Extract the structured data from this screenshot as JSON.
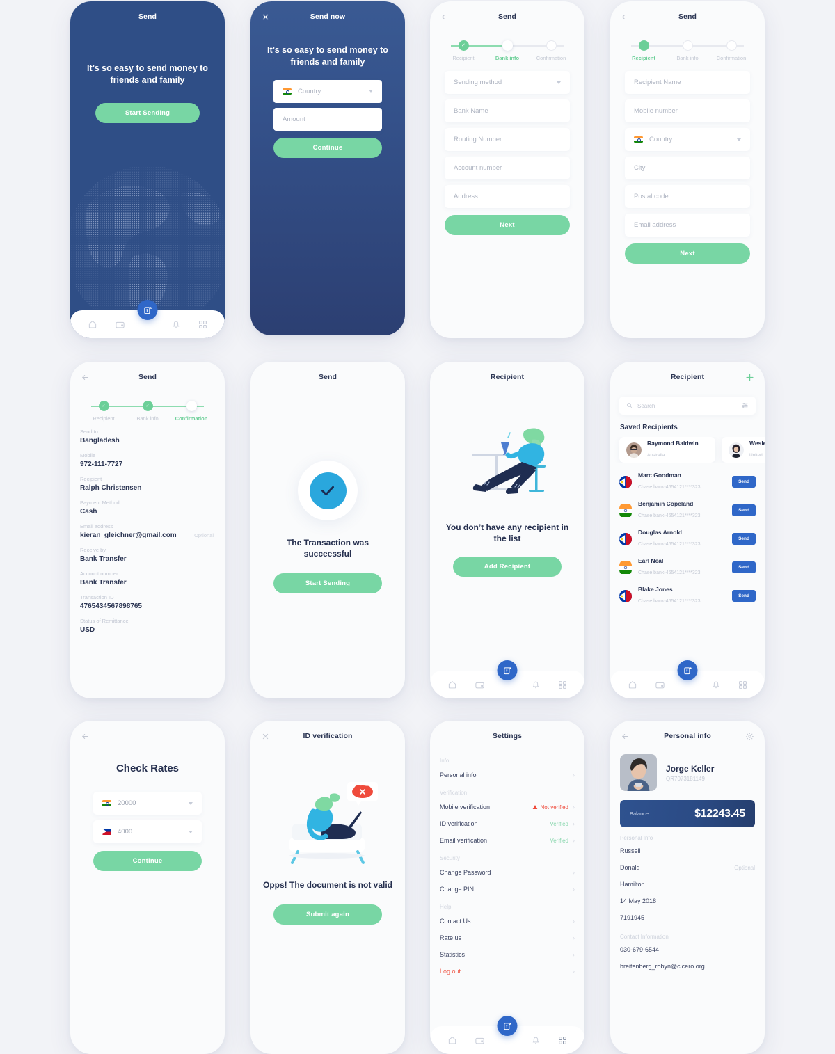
{
  "palette": {
    "page_bg": "#f2f3f7",
    "phone_bg": "#fafbfc",
    "brand_blue": "#2f67c8",
    "dark_navy": "#2f4e86",
    "accent_green": "#78d6a4",
    "step_green": "#6ccf98",
    "danger_red": "#ef4b3c",
    "text_dark": "#2b3553",
    "text_muted": "#c3c8d3"
  },
  "screens": {
    "onboarding": {
      "title": "Send",
      "headline": "It’s so easy to send money to friends and family",
      "cta": "Start Sending"
    },
    "send_now": {
      "title": "Send now",
      "close_icon": "close-icon",
      "headline": "It’s so easy to send money to friends and family",
      "country_placeholder": "Country",
      "amount_placeholder": "Amount",
      "cta": "Continue"
    },
    "bank_info": {
      "title": "Send",
      "back_icon": "back-arrow-icon",
      "steps": [
        {
          "label": "Recipient",
          "state": "done"
        },
        {
          "label": "Bank info",
          "state": "current"
        },
        {
          "label": "Confirmation",
          "state": "todo"
        }
      ],
      "fields": [
        {
          "placeholder": "Sending method",
          "type": "select"
        },
        {
          "placeholder": "Bank Name",
          "type": "text"
        },
        {
          "placeholder": "Routing Number",
          "type": "text"
        },
        {
          "placeholder": "Account number",
          "type": "text"
        },
        {
          "placeholder": "Address",
          "type": "text"
        }
      ],
      "cta": "Next"
    },
    "recipient_form": {
      "title": "Send",
      "back_icon": "back-arrow-icon",
      "steps": [
        {
          "label": "Recipient",
          "state": "current-filled"
        },
        {
          "label": "Bank info",
          "state": "todo"
        },
        {
          "label": "Confirmation",
          "state": "todo"
        }
      ],
      "fields": [
        {
          "placeholder": "Recipient Name",
          "type": "text"
        },
        {
          "placeholder": "Mobile number",
          "type": "text"
        },
        {
          "placeholder": "Country",
          "type": "select",
          "flag": "in"
        },
        {
          "placeholder": "City",
          "type": "text"
        },
        {
          "placeholder": "Postal code",
          "type": "text"
        },
        {
          "placeholder": "Email address",
          "type": "text"
        }
      ],
      "cta": "Next"
    },
    "confirmation": {
      "title": "Send",
      "back_icon": "back-arrow-icon",
      "steps": [
        {
          "label": "Recipient",
          "state": "done"
        },
        {
          "label": "Bank info",
          "state": "done"
        },
        {
          "label": "Confirmation",
          "state": "current"
        }
      ],
      "details": [
        {
          "key": "Send to",
          "value": "Bangladesh",
          "optional": ""
        },
        {
          "key": "Mobile",
          "value": "972-111-7727",
          "optional": ""
        },
        {
          "key": "Recipient",
          "value": "Ralph Christensen",
          "optional": ""
        },
        {
          "key": "Payment Method",
          "value": "Cash",
          "optional": ""
        },
        {
          "key": "Email address",
          "value": "kieran_gleichner@gmail.com",
          "optional": "Optional"
        },
        {
          "key": "Receive by",
          "value": "Bank Transfer",
          "optional": ""
        },
        {
          "key": "Account number",
          "value": "Bank Transfer",
          "optional": ""
        },
        {
          "key": "Transaction ID",
          "value": "4765434567898765",
          "optional": ""
        },
        {
          "key": "Status of Remittance",
          "value": "USD",
          "optional": ""
        }
      ]
    },
    "success": {
      "title": "Send",
      "check_icon": "check-icon",
      "message": "The Transaction was succeessful",
      "cta": "Start Sending"
    },
    "empty_recipient": {
      "title": "Recipient",
      "illustration": "person-at-table-illustration",
      "message": "You don’t have any recipient in the list",
      "cta": "Add Recipient"
    },
    "recipient_list": {
      "title": "Recipient",
      "add_icon": "plus-icon",
      "search_placeholder": "Search",
      "search_icon": "search-icon",
      "filter_icon": "filter-icon",
      "section_title": "Saved Recipients",
      "cards": [
        {
          "name": "Raymond Baldwin",
          "country": "Australia"
        },
        {
          "name": "Wesley",
          "country": "United"
        }
      ],
      "rows": [
        {
          "name": "Marc Goodman",
          "bank": "Chase bank-4654121****323",
          "flag": "ph",
          "action": "Send"
        },
        {
          "name": "Benjamin Copeland",
          "bank": "Chase bank-4654121****323",
          "flag": "in",
          "action": "Send"
        },
        {
          "name": "Douglas Arnold",
          "bank": "Chase bank-4654121****323",
          "flag": "ph",
          "action": "Send"
        },
        {
          "name": "Earl Neal",
          "bank": "Chase bank-4654121****323",
          "flag": "in",
          "action": "Send"
        },
        {
          "name": "Blake Jones",
          "bank": "Chase bank-4654121****323",
          "flag": "ph",
          "action": "Send"
        }
      ]
    },
    "check_rates": {
      "back_icon": "back-arrow-icon",
      "heading": "Check Rates",
      "from": {
        "flag": "in",
        "value": "20000"
      },
      "to": {
        "flag": "ph",
        "value": "4000"
      },
      "cta": "Continue"
    },
    "id_verification": {
      "title": "ID verification",
      "close_icon": "close-icon",
      "illustration": "person-on-couch-with-laptop-illustration",
      "badge_icon": "error-cloud-icon",
      "message": "Opps! The document is not valid",
      "cta": "Submit again"
    },
    "settings": {
      "title": "Settings",
      "groups": [
        {
          "label": "Info",
          "items": [
            {
              "label": "Personal info"
            }
          ]
        },
        {
          "label": "Verification",
          "items": [
            {
              "label": "Mobile verification",
              "status": "Not verified",
              "status_type": "error"
            },
            {
              "label": "ID verification",
              "status": "Verified",
              "status_type": "ok"
            },
            {
              "label": "Email verification",
              "status": "Verified",
              "status_type": "ok"
            }
          ]
        },
        {
          "label": "Security",
          "items": [
            {
              "label": "Change Password"
            },
            {
              "label": "Change PIN"
            }
          ]
        },
        {
          "label": "Help",
          "items": [
            {
              "label": "Contact Us"
            },
            {
              "label": "Rate us"
            },
            {
              "label": "Statistics"
            },
            {
              "label": "Log out",
              "danger": true
            }
          ]
        }
      ]
    },
    "personal_info": {
      "title": "Personal info",
      "back_icon": "back-arrow-icon",
      "gear_icon": "gear-icon",
      "name": "Jorge Keller",
      "code": "QR7073181149",
      "balance_label": "Balance",
      "balance_amount": "$12243.45",
      "group_personal": "Personal Info",
      "personal_rows": [
        {
          "value": "Russell",
          "optional": ""
        },
        {
          "value": "Donald",
          "optional": "Optional"
        },
        {
          "value": "Hamilton",
          "optional": ""
        },
        {
          "value": "14 May 2018",
          "optional": ""
        },
        {
          "value": "7191945",
          "optional": ""
        }
      ],
      "group_contact": "Contact Information",
      "contact_rows": [
        {
          "value": "030-679-6544"
        },
        {
          "value": "breitenberg_robyn@cicero.org"
        }
      ]
    }
  },
  "bottom_nav": {
    "items": [
      "home-icon",
      "wallet-icon",
      "send-money-fab-icon",
      "bell-icon",
      "grid-icon"
    ]
  }
}
